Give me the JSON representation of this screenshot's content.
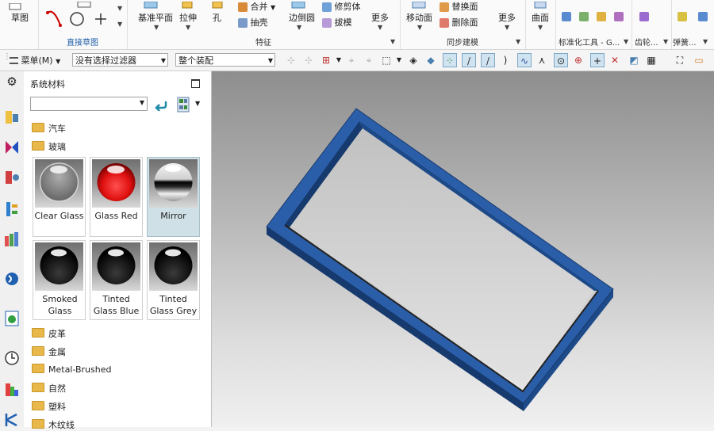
{
  "ribbon": {
    "sketch_label": "草图",
    "direct_sketch_caption": "直接草图",
    "datum_plane_label": "基准平面",
    "extrude_label": "拉伸",
    "hole_label": "孔",
    "unite_label": "合并",
    "shell_label": "抽壳",
    "edge_blend_label": "边倒圆",
    "trim_body_label": "修剪体",
    "draft_label": "拔模",
    "more_label": "更多",
    "feature_caption": "特征",
    "move_face_label": "移动面",
    "replace_face_label": "替换面",
    "delete_face_label": "删除面",
    "sync_modeling_caption": "同步建模",
    "more_label_2": "更多",
    "surface_label": "曲面",
    "standard_tools_caption": "标准化工具 - G...",
    "gear_caption": "齿轮...",
    "spring_caption": "弹簧..."
  },
  "toolbar": {
    "menu_label": "菜单(M)",
    "filter_value": "没有选择过滤器",
    "assembly_value": "整个装配"
  },
  "panel": {
    "title": "系统材料",
    "folders_top": [
      "汽车",
      "玻璃"
    ],
    "materials": [
      {
        "label": "Clear Glass",
        "type": "clear"
      },
      {
        "label": "Glass Red",
        "type": "red"
      },
      {
        "label": "Mirror",
        "type": "mirror",
        "selected": true
      },
      {
        "label": "Smoked Glass",
        "type": "black"
      },
      {
        "label": "Tinted Glass Blue",
        "type": "black"
      },
      {
        "label": "Tinted Glass Grey",
        "type": "black"
      }
    ],
    "folders_bottom": [
      "皮革",
      "金属",
      "Metal-Brushed",
      "自然",
      "塑料",
      "木纹线"
    ]
  },
  "colors": {
    "frame_blue": "#2b5ea8",
    "frame_dark": "#173a6e",
    "glass_red": "#e01010",
    "folder": "#e8b84a"
  }
}
